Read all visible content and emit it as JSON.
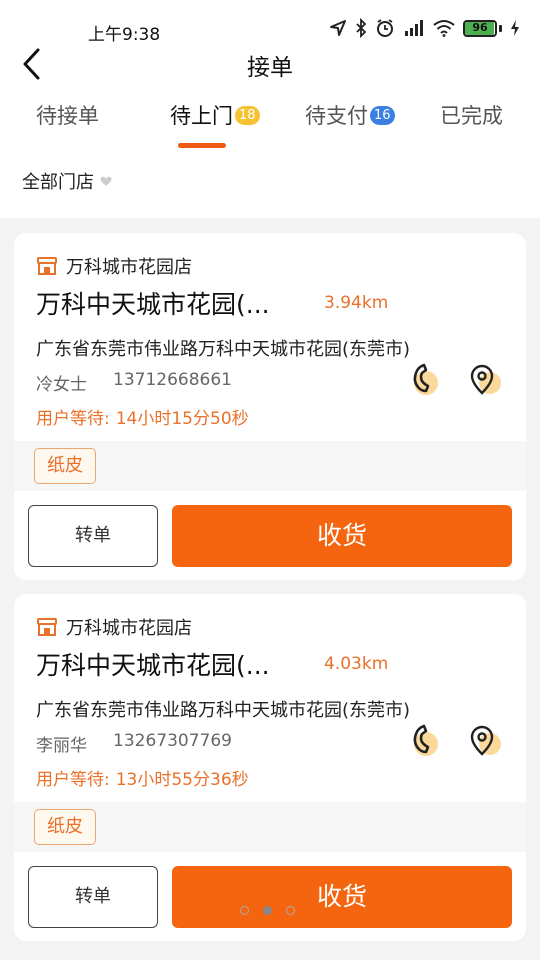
{
  "status_bar": {
    "time": "上午9:38",
    "battery_level": "96",
    "battery_fraction": 0.96,
    "icons": [
      "location-arrow-icon",
      "bluetooth-icon",
      "alarm-icon",
      "signal-icon",
      "wifi-icon",
      "battery-icon",
      "charging-icon"
    ]
  },
  "header": {
    "title": "接单"
  },
  "tabs": [
    {
      "label": "待接单",
      "badge": ""
    },
    {
      "label": "待上门",
      "badge": "18",
      "badge_color": "#f5c232",
      "active": true
    },
    {
      "label": "待支付",
      "badge": "16",
      "badge_color": "#3b7fe0"
    },
    {
      "label": "已完成",
      "badge": ""
    }
  ],
  "filter": {
    "label": "全部门店"
  },
  "orders": [
    {
      "store": "万科城市花园店",
      "title": "万科中天城市花园(...",
      "distance": "3.94km",
      "address": "广东省东莞市伟业路万科中天城市花园(东莞市)",
      "name": "冷女士",
      "phone": "13712668661",
      "wait_label": "用户等待:",
      "wait_time": "14小时15分50秒",
      "tag": "纸皮",
      "transfer_label": "转单",
      "receive_label": "收货"
    },
    {
      "store": "万科城市花园店",
      "title": "万科中天城市花园(...",
      "distance": "4.03km",
      "address": "广东省东莞市伟业路万科中天城市花园(东莞市)",
      "name": "李丽华",
      "phone": "13267307769",
      "wait_label": "用户等待:",
      "wait_time": "13小时55分36秒",
      "tag": "纸皮",
      "transfer_label": "转单",
      "receive_label": "收货"
    }
  ],
  "colors": {
    "accent": "#f5650f",
    "accent_text": "#e9712a"
  }
}
